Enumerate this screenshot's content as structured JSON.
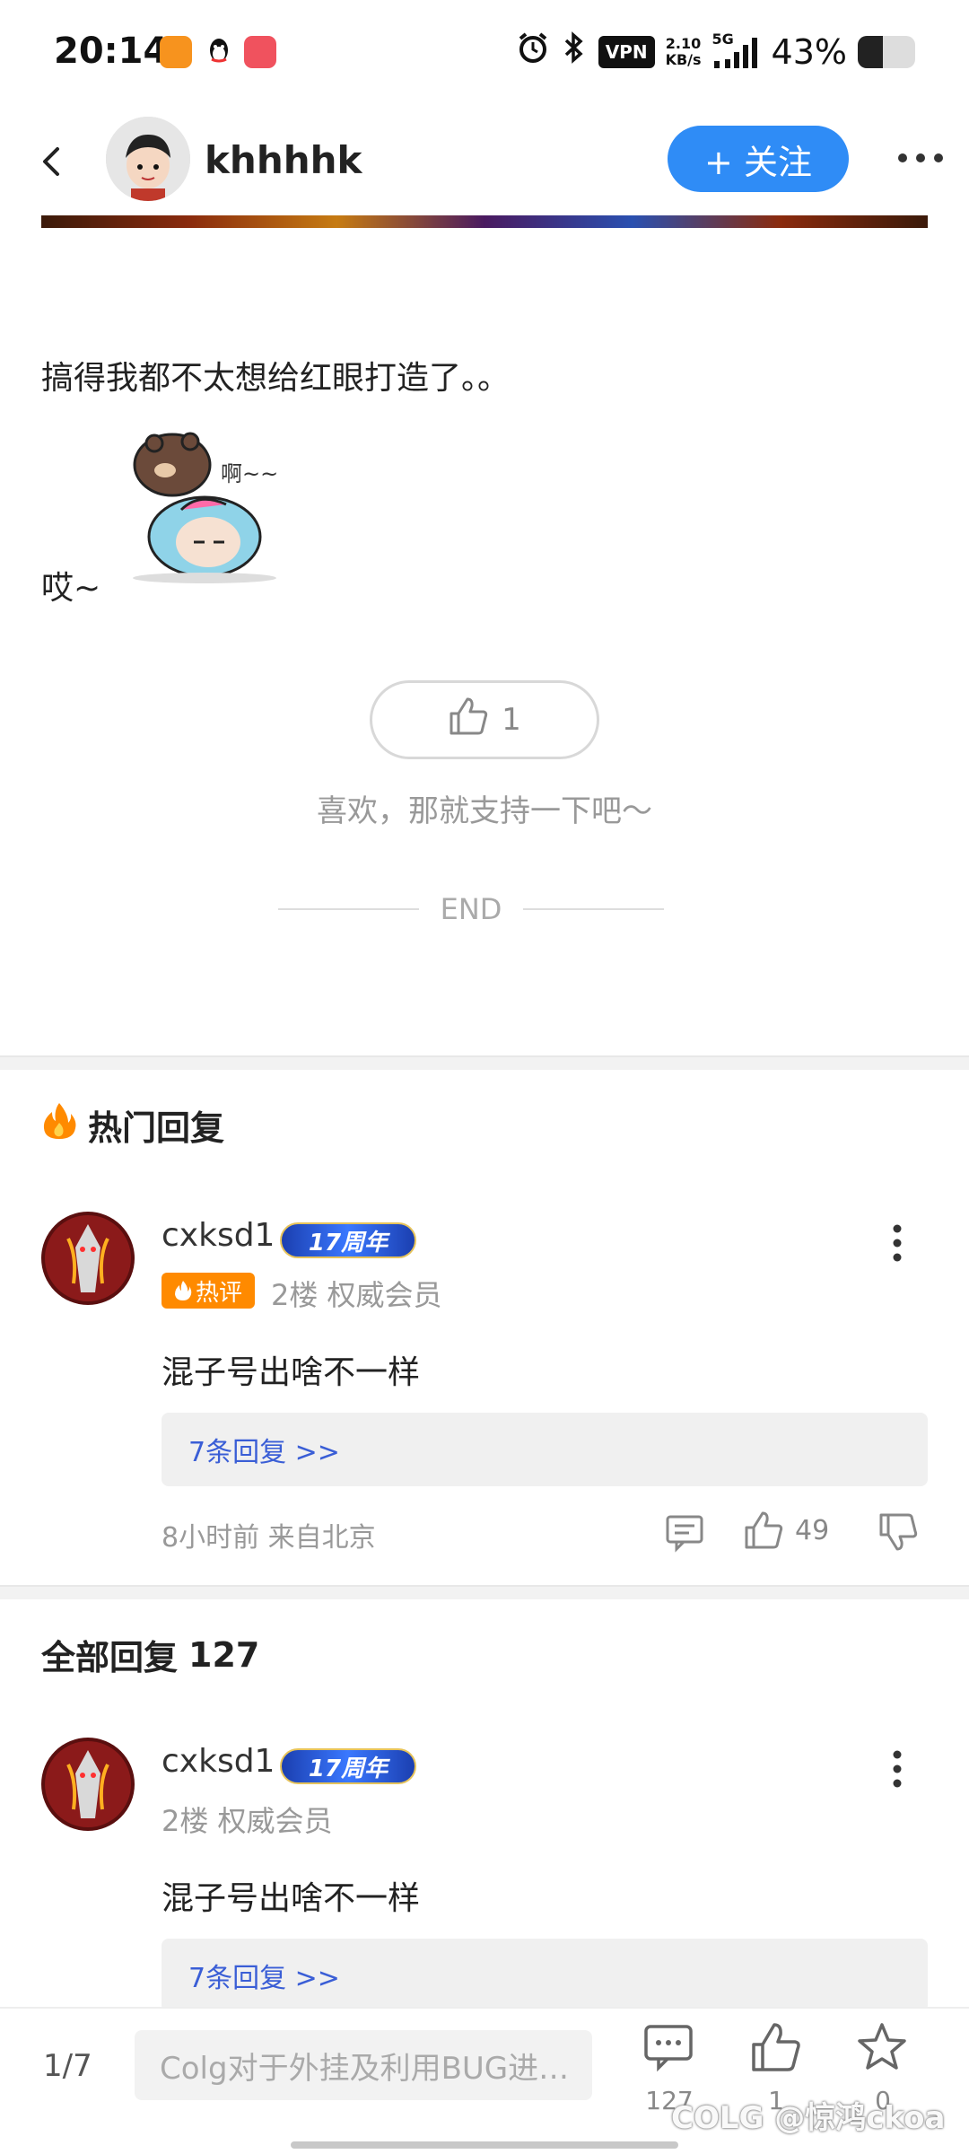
{
  "status_bar": {
    "time": "20:14",
    "vpn": "VPN",
    "net_rate_value": "2.10",
    "net_rate_unit": "KB/s",
    "signal_label": "5G",
    "battery_percent": "43%",
    "battery_level": 0.43
  },
  "header": {
    "username": "khhhhk",
    "follow_label": "+ 关注"
  },
  "post": {
    "line1": "搞得我都不太想给红眼打造了。。",
    "line2": "哎~",
    "sticker_caption": "啊~~",
    "like_count": "1",
    "support_text": "喜欢，那就支持一下吧～",
    "end_label": "END"
  },
  "hot_replies": {
    "title": "热门回复",
    "comment": {
      "user": "cxksd1",
      "badge": "17周年",
      "hot_label": "热评",
      "floor_info": "2楼 权威会员",
      "text": "混子号出啥不一样",
      "replies_link": "7条回复 >>",
      "time_location": "8小时前 来自北京",
      "likes": "49"
    }
  },
  "all_replies": {
    "title": "全部回复",
    "count": "127",
    "comment": {
      "user": "cxksd1",
      "badge": "17周年",
      "floor_info": "2楼 权威会员",
      "text": "混子号出啥不一样",
      "replies_link": "7条回复 >>"
    }
  },
  "bottom_bar": {
    "page_indicator": "1/7",
    "input_placeholder": "Colg对于外挂及利用BUG进…",
    "comments_count": "127",
    "likes_count": "1",
    "favorites_count": "0",
    "watermark": "COLG @惊鸿ckoa"
  },
  "colors": {
    "accent_blue": "#2f8cf6",
    "hot_orange": "#ff8a00",
    "link_blue": "#3a5ed6"
  }
}
